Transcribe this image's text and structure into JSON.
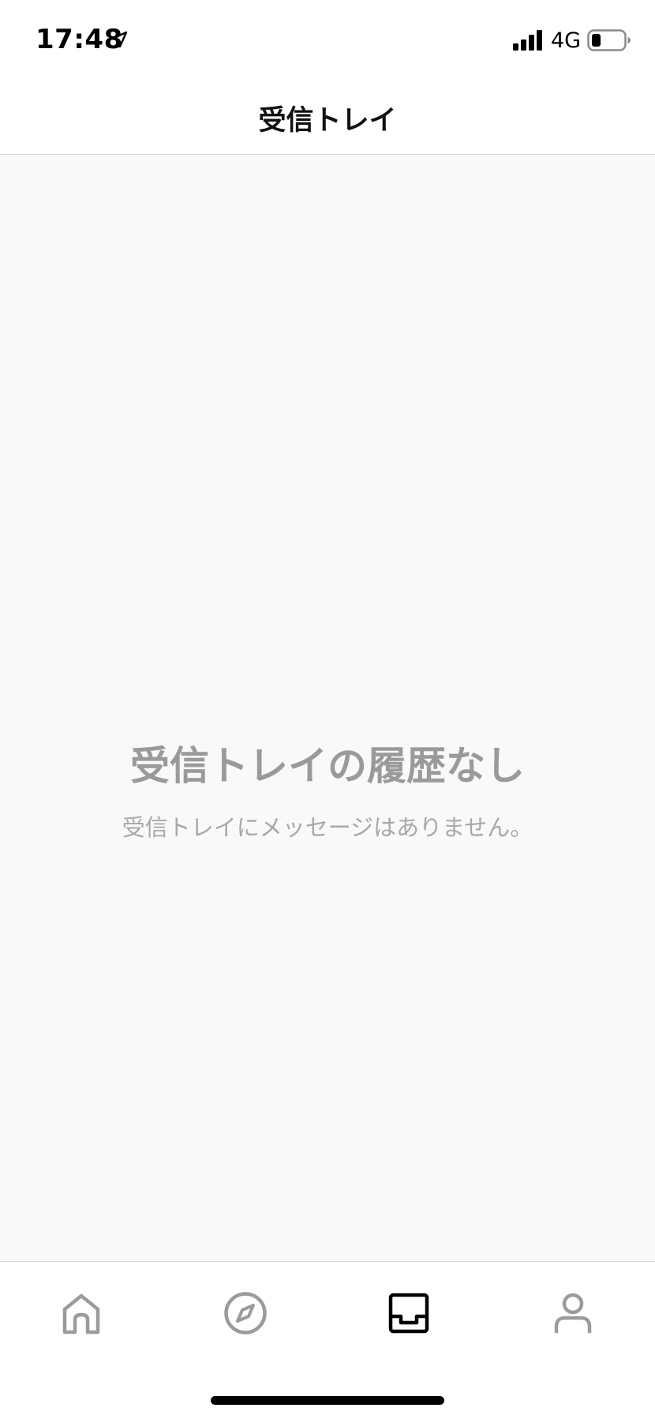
{
  "status_bar": {
    "time": "17:48",
    "network": "4G",
    "icons": [
      "location-arrow-icon",
      "signal-bars-icon",
      "battery-icon"
    ]
  },
  "header": {
    "title": "受信トレイ"
  },
  "empty_state": {
    "title": "受信トレイの履歴なし",
    "message": "受信トレイにメッセージはありません。"
  },
  "tab_bar": {
    "tabs": [
      {
        "icon": "home-icon",
        "active": false
      },
      {
        "icon": "compass-icon",
        "active": false
      },
      {
        "icon": "inbox-icon",
        "active": true
      },
      {
        "icon": "person-icon",
        "active": false
      }
    ]
  },
  "colors": {
    "active_tab": "#000000",
    "inactive_tab": "#9b9b9b",
    "content_background": "#f9f9f9",
    "empty_title": "#9a9a9a",
    "empty_message": "#a8a8a8"
  }
}
